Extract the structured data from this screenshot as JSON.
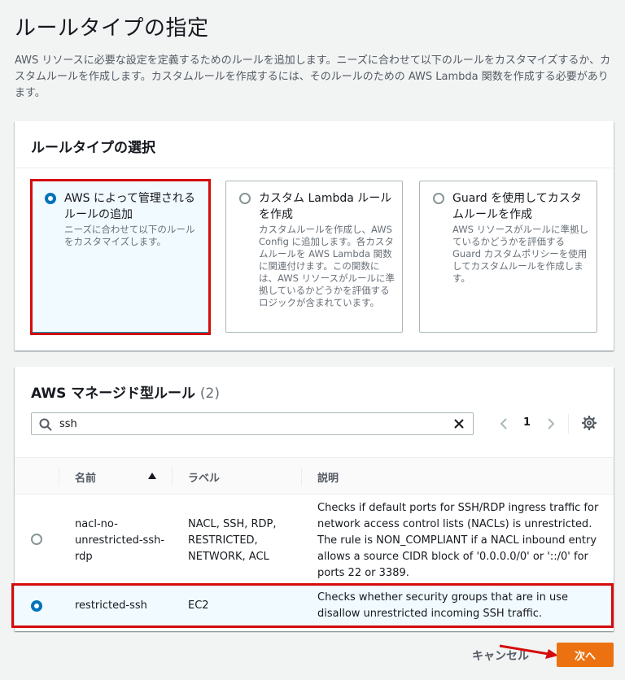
{
  "page": {
    "title": "ルールタイプの指定",
    "description": "AWS リソースに必要な設定を定義するためのルールを追加します。ニーズに合わせて以下のルールをカスタマイズするか、カスタムルールを作成します。カスタムルールを作成するには、そのルールのための AWS Lambda 関数を作成する必要があります。"
  },
  "rule_type": {
    "heading": "ルールタイプの選択",
    "options": [
      {
        "title": "AWS によって管理されるルールの追加",
        "desc": "ニーズに合わせて以下のルールをカスタマイズします。",
        "selected": true
      },
      {
        "title": "カスタム Lambda ルールを作成",
        "desc": "カスタムルールを作成し、AWS Config に追加します。各カスタムルールを AWS Lambda 関数に関連付けます。この関数には、AWS リソースがルールに準拠しているかどうかを評価するロジックが含まれています。",
        "selected": false
      },
      {
        "title": "Guard を使用してカスタムルールを作成",
        "desc": "AWS リソースがルールに準拠しているかどうかを評価する Guard カスタムポリシーを使用してカスタムルールを作成します。",
        "selected": false
      }
    ]
  },
  "managed_rules": {
    "heading": "AWS マネージド型ルール",
    "count": "(2)",
    "search": {
      "value": "ssh",
      "placeholder": ""
    },
    "page_number": "1",
    "columns": {
      "name": "名前",
      "label": "ラベル",
      "description": "説明"
    },
    "rows": [
      {
        "name": "nacl-no-unrestricted-ssh-rdp",
        "label": "NACL, SSH, RDP, RESTRICTED, NETWORK, ACL",
        "description": "Checks if default ports for SSH/RDP ingress traffic for network access control lists (NACLs) is unrestricted. The rule is NON_COMPLIANT if a NACL inbound entry allows a source CIDR block of '0.0.0.0/0' or '::/0' for ports 22 or 3389.",
        "selected": false
      },
      {
        "name": "restricted-ssh",
        "label": "EC2",
        "description": "Checks whether security groups that are in use disallow unrestricted incoming SSH traffic.",
        "selected": true
      }
    ]
  },
  "footer": {
    "cancel_label": "キャンセル",
    "next_label": "次へ"
  },
  "colors": {
    "primary_button": "#ec7211",
    "selection_blue": "#0073bb",
    "highlight_red": "#d50b0b"
  }
}
